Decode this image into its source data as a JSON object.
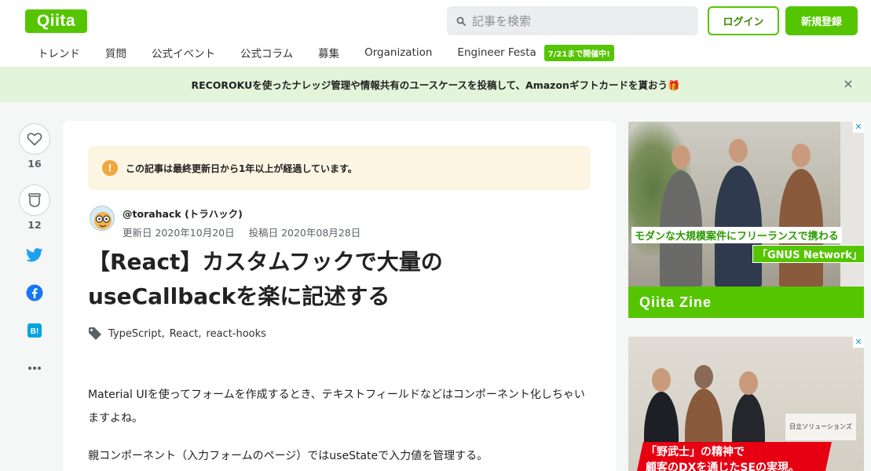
{
  "header": {
    "logo": "Qiita",
    "search_placeholder": "記事を検索",
    "login": "ログイン",
    "signup": "新規登録"
  },
  "nav": {
    "items": [
      "トレンド",
      "質問",
      "公式イベント",
      "公式コラム",
      "募集",
      "Organization",
      "Engineer Festa"
    ],
    "badge": "7/21まで開催中!"
  },
  "banner": {
    "text": "RECOROKUを使ったナレッジ管理や情報共有のユースケースを投稿して、Amazonギフトカードを貰おう🎁",
    "close": "×"
  },
  "actions": {
    "like_count": "16",
    "stock_count": "12"
  },
  "article": {
    "notice": "この記事は最終更新日から1年以上が経過しています。",
    "notice_icon": "!",
    "author": "@torahack (トラハック)",
    "updated": "更新日 2020年10月20日",
    "posted": "投稿日 2020年08月28日",
    "title": "【React】カスタムフックで大量のuseCallbackを楽に記述する",
    "tags": [
      "TypeScript",
      "React",
      "react-hooks"
    ],
    "tag_separator": ",",
    "paragraphs": [
      "Material UIを使ってフォームを作成するとき、テキストフィールドなどはコンポーネント化しちゃいますよね。",
      "親コンポーネント（入力フォームのページ）ではuseStateで入力値を管理する。"
    ]
  },
  "ads": {
    "ad1": {
      "caption1": "モダンな大規模案件にフリーランスで携わる",
      "caption2": "「GNUS Network」",
      "footer": "Qiita Zine",
      "close": "✕"
    },
    "ad2": {
      "sign": "日立ソリューションズ",
      "line1": "「野武士」の精神で",
      "line2": "顧客のDXを通じたSEの実現。",
      "close": "✕"
    }
  },
  "colors": {
    "brand": "#55c500",
    "banner_bg": "#e2f4da",
    "notice_bg": "#fcf5e2",
    "twitter": "#1da1f2",
    "facebook": "#1877f2",
    "hatena": "#00a4de"
  }
}
